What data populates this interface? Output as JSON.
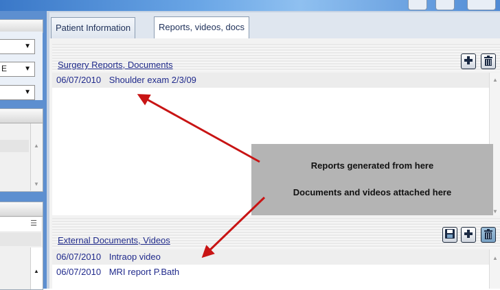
{
  "tabs": [
    {
      "label": "Patient Information",
      "active": false
    },
    {
      "label": "Reports, videos, docs",
      "active": true
    }
  ],
  "surgery_section": {
    "title": "Surgery Reports, Documents",
    "rows": [
      {
        "date": "06/07/2010",
        "name": "Shoulder exam 2/3/09"
      }
    ],
    "buttons": [
      "add-icon",
      "delete-icon"
    ]
  },
  "external_section": {
    "title": "External Documents, Videos",
    "rows": [
      {
        "date": "06/07/2010",
        "name": "Intraop video"
      },
      {
        "date": "06/07/2010",
        "name": "MRI report P.Bath"
      }
    ],
    "buttons": [
      "save-icon",
      "add-icon",
      "delete-icon"
    ]
  },
  "callout": {
    "line1": "Reports generated from here",
    "line2": "Documents and videos attached here"
  },
  "left_panel": {
    "dropdown_partial_text": "E"
  },
  "colors": {
    "link_text": "#1f2a8a",
    "arrow": "#c81414",
    "callout_bg": "#b4b4b4",
    "window_blue": "#5d8fd0"
  }
}
